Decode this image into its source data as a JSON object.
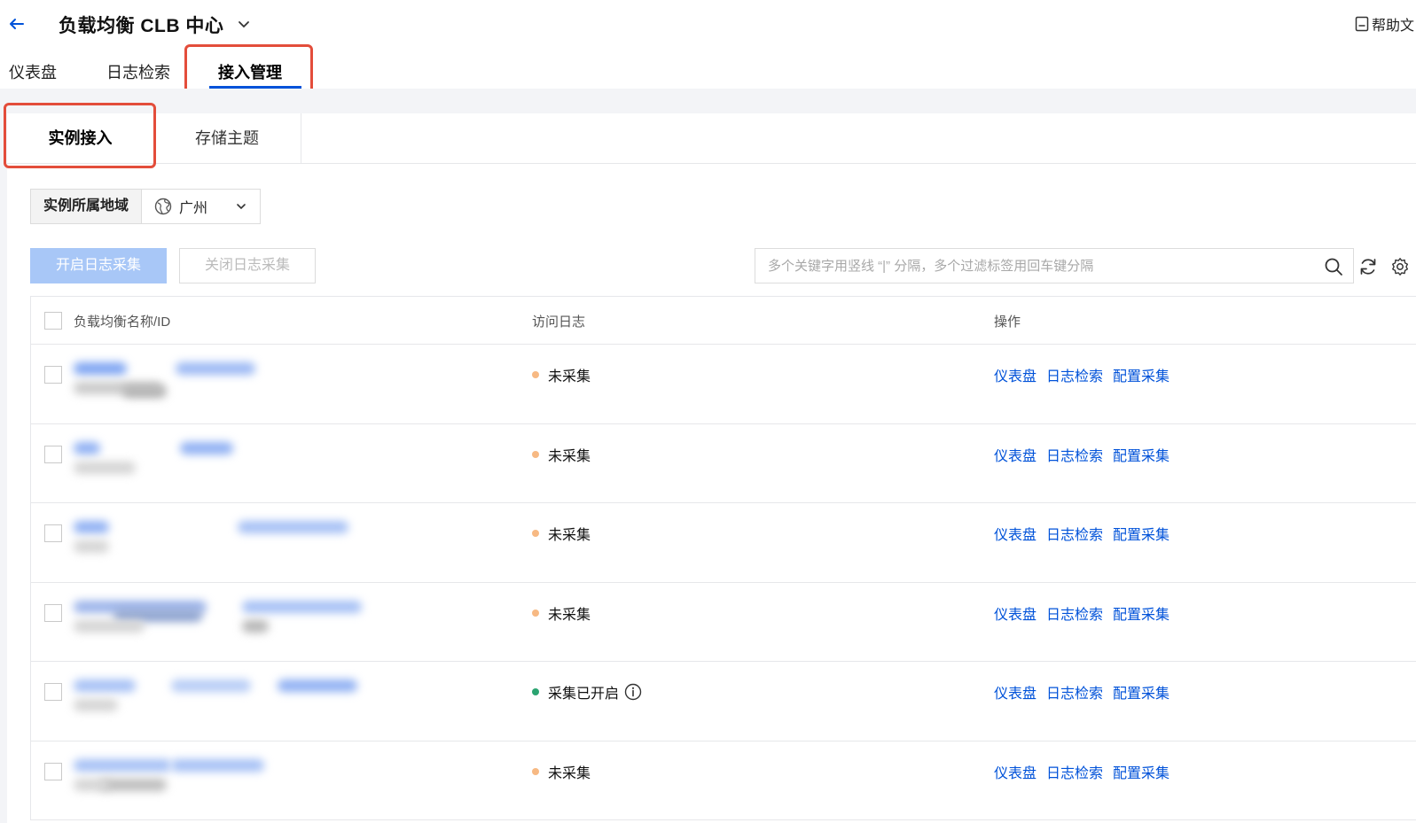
{
  "header": {
    "title": "负载均衡 CLB 中心",
    "help": "帮助文"
  },
  "top_tabs": [
    {
      "label": "仪表盘",
      "active": false
    },
    {
      "label": "日志检索",
      "active": false
    },
    {
      "label": "接入管理",
      "active": true
    }
  ],
  "sub_tabs": [
    {
      "label": "实例接入",
      "active": true
    },
    {
      "label": "存储主题",
      "active": false
    }
  ],
  "region": {
    "label": "实例所属地域",
    "value": "广州"
  },
  "buttons": {
    "enable": "开启日志采集",
    "disable": "关闭日志采集"
  },
  "search": {
    "placeholder": "多个关键字用竖线 “|” 分隔，多个过滤标签用回车键分隔",
    "value": ""
  },
  "table": {
    "columns": [
      "负载均衡名称/ID",
      "访问日志",
      "操作"
    ],
    "actions": [
      "仪表盘",
      "日志检索",
      "配置采集"
    ],
    "rows": [
      {
        "status": "未采集",
        "status_color": "#f7b983",
        "has_info": false
      },
      {
        "status": "未采集",
        "status_color": "#f7b983",
        "has_info": false
      },
      {
        "status": "未采集",
        "status_color": "#f7b983",
        "has_info": false
      },
      {
        "status": "未采集",
        "status_color": "#f7b983",
        "has_info": false
      },
      {
        "status": "采集已开启",
        "status_color": "#2ba471",
        "has_info": true
      },
      {
        "status": "未采集",
        "status_color": "#f7b983",
        "has_info": false
      }
    ]
  },
  "colors": {
    "accent": "#0052d9",
    "highlight": "#e34d3b",
    "primary_disabled": "#a8c7f7"
  },
  "icons": [
    "back-arrow-icon",
    "chevron-down-icon",
    "help-doc-icon",
    "globe-icon",
    "search-icon",
    "refresh-icon",
    "settings-icon",
    "info-icon"
  ]
}
